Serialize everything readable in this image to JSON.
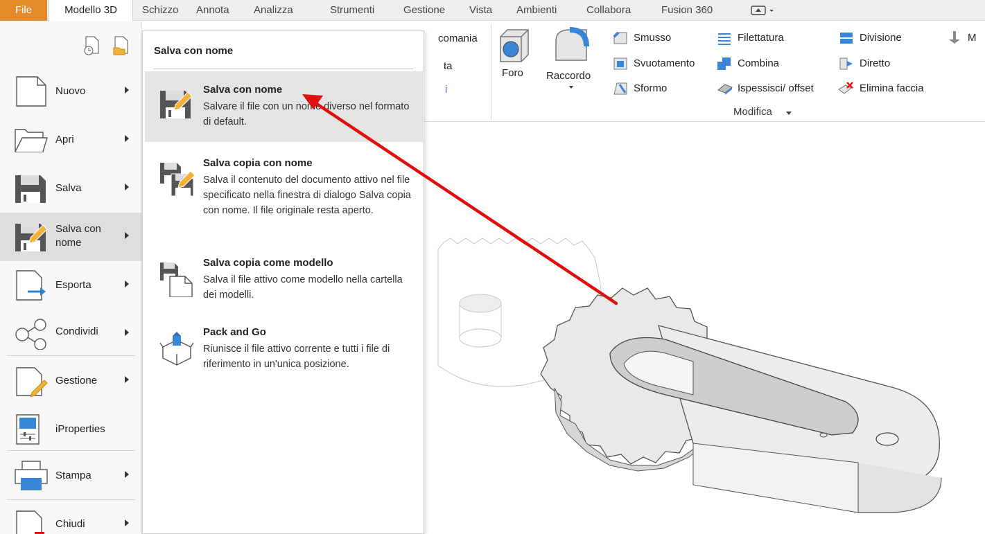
{
  "tabs": [
    "File",
    "Modello 3D",
    "Schizzo",
    "Annota",
    "Analizza",
    "Strumenti",
    "Gestione",
    "Vista",
    "Ambienti",
    "Collabora",
    "Fusion 360"
  ],
  "ribbon": {
    "partial_top": "comania",
    "partial_mid": "ta",
    "partial_bot": "i",
    "foro": "Foro",
    "raccordo": "Raccordo",
    "smusso": "Smusso",
    "svuotamento": "Svuotamento",
    "sformo": "Sformo",
    "filettatura": "Filettatura",
    "combina": "Combina",
    "ispessisci": "Ispessisci/ offset",
    "divisione": "Divisione",
    "diretto": "Diretto",
    "elimina_faccia": "Elimina faccia",
    "cut_right": "M",
    "panel_label": "Modifica"
  },
  "file_menu": {
    "items": [
      {
        "label": "Nuovo"
      },
      {
        "label": "Apri"
      },
      {
        "label": "Salva"
      },
      {
        "label": "Salva con nome"
      },
      {
        "label": "Esporta"
      },
      {
        "label": "Condividi"
      },
      {
        "label": "Gestione"
      },
      {
        "label": "iProperties"
      },
      {
        "label": "Stampa"
      },
      {
        "label": "Chiudi"
      }
    ]
  },
  "submenu": {
    "title": "Salva con nome",
    "items": [
      {
        "title": "Salva con nome",
        "desc": "Salvare il file con un nome diverso nel formato di default."
      },
      {
        "title": "Salva copia con nome",
        "desc": "Salva il contenuto del documento attivo nel file specificato nella finestra di dialogo Salva copia con nome. Il file originale resta aperto."
      },
      {
        "title": "Salva copia come modello",
        "desc": "Salva il file attivo come modello nella cartella dei modelli."
      },
      {
        "title": "Pack and Go",
        "desc": "Riunisce il file attivo corrente e tutti i file di riferimento in un'unica posizione."
      }
    ]
  },
  "colors": {
    "file_tab": "#e58a2a",
    "arrow": "#e01010",
    "accent_blue": "#2f7fd3"
  }
}
